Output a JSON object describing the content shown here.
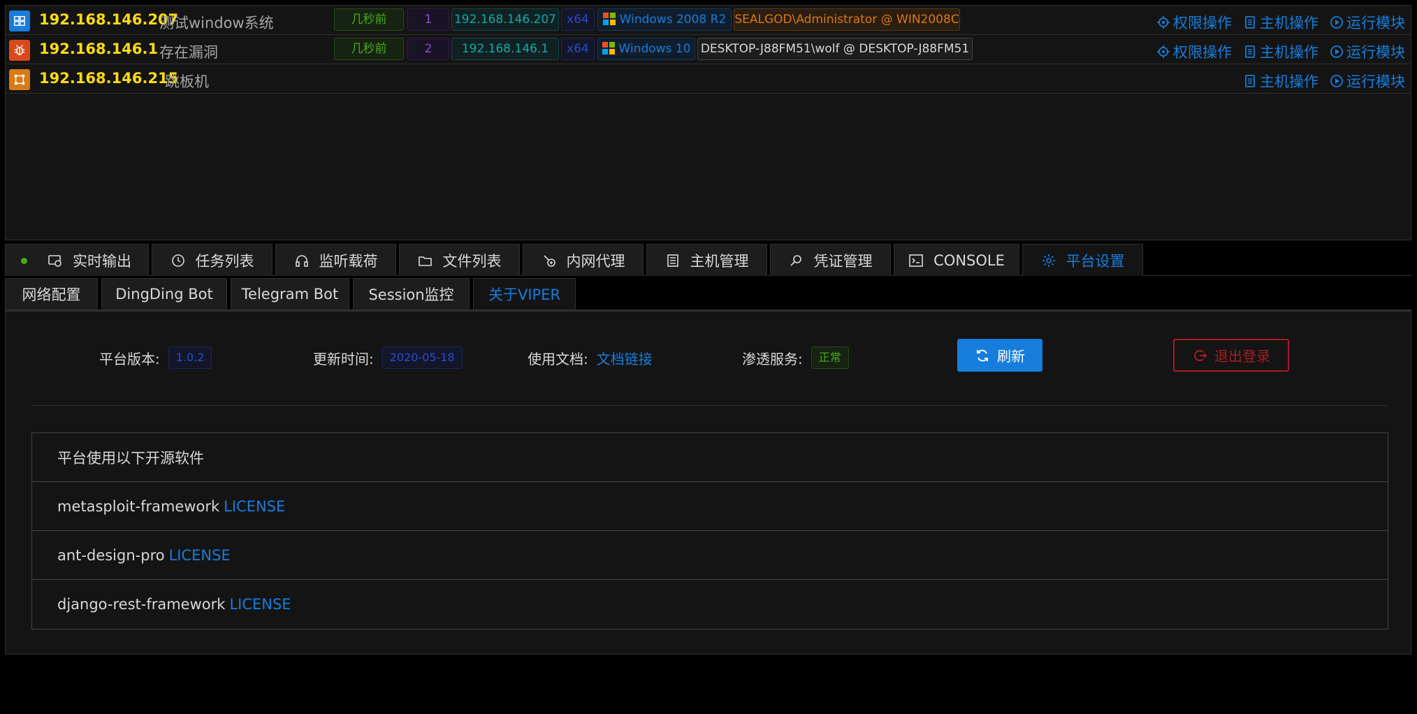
{
  "hosts": [
    {
      "ip": "192.168.146.207",
      "desc": "测试window系统",
      "icon": "windows-icon",
      "time": "几秒前",
      "session_count": "1",
      "session_ip": "192.168.146.207",
      "arch": "x64",
      "os": "Windows 2008 R2",
      "user": "SEALGOD\\Administrator @ WIN2008C",
      "actions": [
        "权限操作",
        "主机操作",
        "运行模块"
      ]
    },
    {
      "ip": "192.168.146.1",
      "desc": "存在漏洞",
      "icon": "bug-icon",
      "time": "几秒前",
      "session_count": "2",
      "session_ip": "192.168.146.1",
      "arch": "x64",
      "os": "Windows 10",
      "user": "DESKTOP-J88FM51\\wolf @ DESKTOP-J88FM51",
      "actions": [
        "权限操作",
        "主机操作",
        "运行模块"
      ]
    },
    {
      "ip": "192.168.146.215",
      "desc": "跳板机",
      "icon": "gateway-icon",
      "actions": [
        "主机操作",
        "运行模块"
      ]
    }
  ],
  "main_tabs": [
    "实时输出",
    "任务列表",
    "监听载荷",
    "文件列表",
    "内网代理",
    "主机管理",
    "凭证管理",
    "CONSOLE",
    "平台设置"
  ],
  "sub_tabs": [
    "网络配置",
    "DingDing Bot",
    "Telegram Bot",
    "Session监控",
    "关于VIPER"
  ],
  "about": {
    "version_label": "平台版本:",
    "version": "1.0.2",
    "update_label": "更新时间:",
    "update": "2020-05-18",
    "docs_label": "使用文档:",
    "docs_link": "文档链接",
    "service_label": "渗透服务:",
    "service_status": "正常",
    "refresh": "刷新",
    "logout": "退出登录"
  },
  "oss": {
    "header": "平台使用以下开源软件",
    "items": [
      {
        "name": "metasploit-framework",
        "license": "LICENSE"
      },
      {
        "name": "ant-design-pro",
        "license": "LICENSE"
      },
      {
        "name": "django-rest-framework",
        "license": "LICENSE"
      }
    ]
  },
  "colors": {
    "accent": "#177ddc",
    "ip": "#fadb14",
    "danger": "#a61d24",
    "success": "#49aa19"
  }
}
